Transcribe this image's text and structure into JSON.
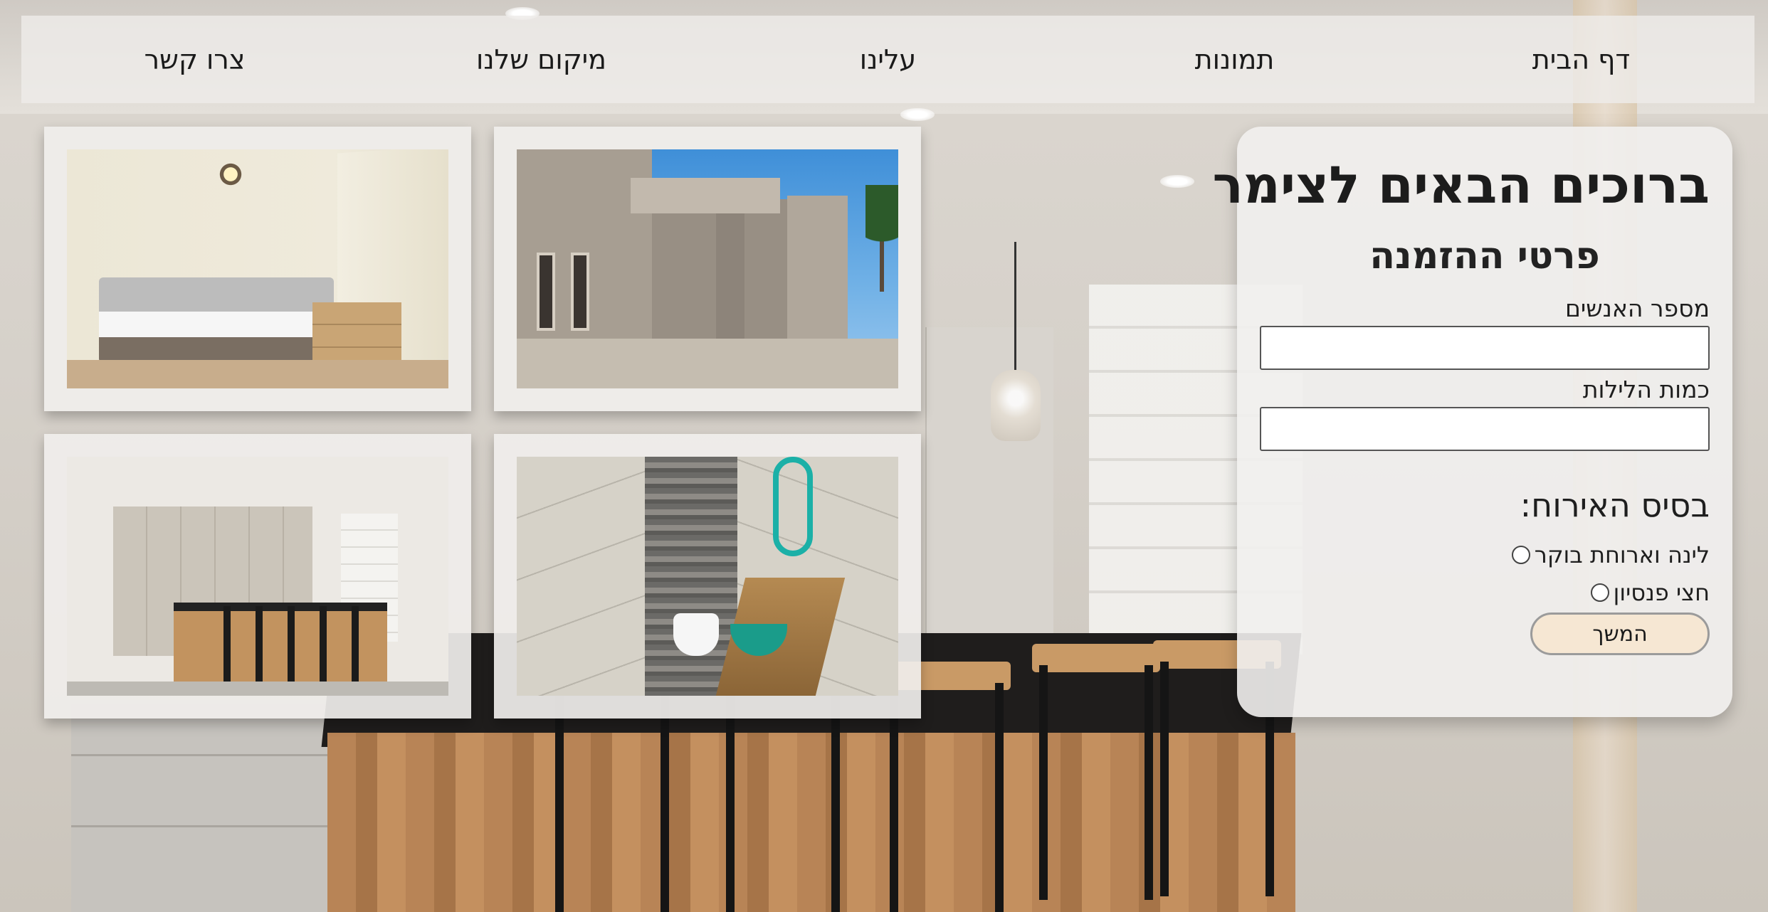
{
  "nav": {
    "items": [
      {
        "label": "דף הבית"
      },
      {
        "label": "תמונות"
      },
      {
        "label": "עלינו"
      },
      {
        "label": "מיקום שלנו"
      },
      {
        "label": "צרו קשר"
      }
    ]
  },
  "gallery": {
    "photos": [
      {
        "icon": "exterior-photo"
      },
      {
        "icon": "bedroom-photo"
      },
      {
        "icon": "bathroom-photo"
      },
      {
        "icon": "kitchen-photo"
      }
    ]
  },
  "booking": {
    "welcome_title": "ברוכים הבאים לצימר",
    "subtitle": "פרטי ההזמנה",
    "people_label": "מספר האנשים",
    "people_value": "",
    "nights_label": "כמות הלילות",
    "nights_value": "",
    "board_heading": "בסיס האירוח:",
    "board_options": [
      {
        "label": "לינה וארוחת בוקר",
        "selected": false
      },
      {
        "label": "חצי פנסיון",
        "selected": false
      }
    ],
    "continue_label": "המשך",
    "button_color": "#f6e7d3"
  }
}
